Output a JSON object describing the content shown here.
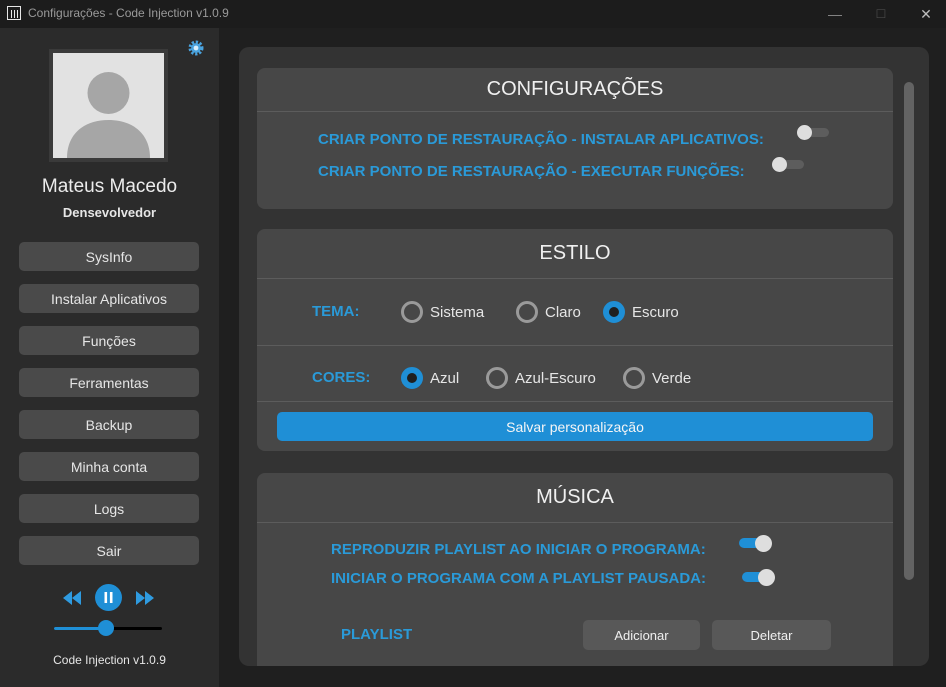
{
  "window": {
    "title": "Configurações - Code Injection v1.0.9",
    "minimize": "—",
    "maximize": "☐",
    "close": "✕"
  },
  "sidebar": {
    "user_name": "Mateus Macedo",
    "user_role": "Densevolvedor",
    "nav": [
      {
        "label": "SysInfo"
      },
      {
        "label": "Instalar Aplicativos"
      },
      {
        "label": "Funções"
      },
      {
        "label": "Ferramentas"
      },
      {
        "label": "Backup"
      },
      {
        "label": "Minha conta"
      },
      {
        "label": "Logs"
      },
      {
        "label": "Sair"
      }
    ],
    "player": {
      "volume_fraction": 0.48,
      "state": "playing"
    },
    "version": "Code Injection v1.0.9"
  },
  "config": {
    "title": "CONFIGURAÇÕES",
    "restore_install_label": "CRIAR PONTO DE RESTAURAÇÃO - INSTALAR APLICATIVOS:",
    "restore_install_on": false,
    "restore_exec_label": "CRIAR PONTO DE RESTAURAÇÃO - EXECUTAR FUNÇÕES:",
    "restore_exec_on": false
  },
  "style": {
    "title": "ESTILO",
    "theme_label": "TEMA:",
    "theme_options": [
      "Sistema",
      "Claro",
      "Escuro"
    ],
    "theme_selected": "Escuro",
    "colors_label": "CORES:",
    "color_options": [
      "Azul",
      "Azul-Escuro",
      "Verde"
    ],
    "color_selected": "Azul",
    "save_label": "Salvar personalização"
  },
  "music": {
    "title": "MÚSICA",
    "autoplay_label": "REPRODUZIR PLAYLIST AO INICIAR O PROGRAMA:",
    "autoplay_on": true,
    "paused_label": "INICIAR O PROGRAMA COM A PLAYLIST PAUSADA:",
    "paused_on": true,
    "playlist_label": "PLAYLIST",
    "add_label": "Adicionar",
    "delete_label": "Deletar"
  },
  "colors": {
    "accent": "#1f8fd6",
    "label_blue": "#2a9ad8",
    "card_bg": "#474747",
    "panel_bg": "#333333",
    "sidebar_bg": "#2b2b2b"
  }
}
